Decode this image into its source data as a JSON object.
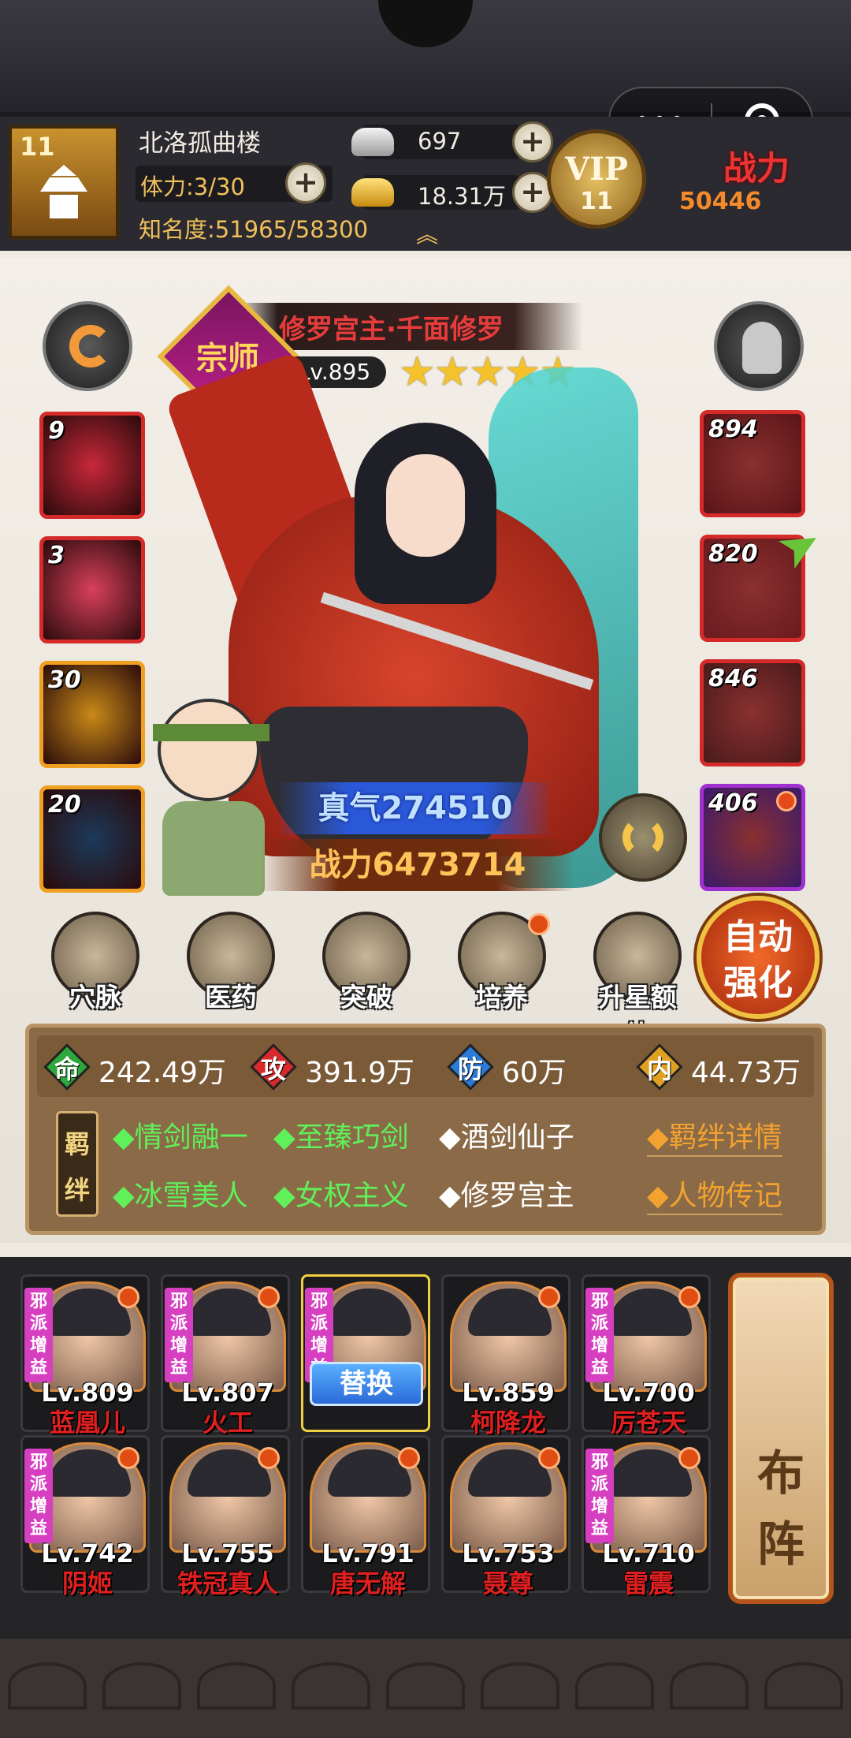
{
  "header": {
    "player_level": "11",
    "player_name": "北洛孤曲楼",
    "stamina": "体力:3/30",
    "fame": "知名度:51965/58300",
    "silver": "697",
    "gold": "18.31万",
    "vip_label": "VIP",
    "vip_level": "11",
    "power_label": "战力",
    "power_value": "50446",
    "capsule_more": "•••"
  },
  "hero": {
    "badge": "宗师",
    "name": "修罗宫主·千面修罗",
    "level": "Lv.895",
    "stars": 5,
    "stars_text": "★★★★★",
    "qi": "真气274510",
    "power": "战力6473714"
  },
  "skills_left": [
    {
      "value": "9",
      "color": "#c8283a"
    },
    {
      "value": "3",
      "color": "#d8405a"
    },
    {
      "value": "30",
      "color": "#c98a18"
    },
    {
      "value": "20",
      "color": "#1c3a5a"
    }
  ],
  "equip_right": [
    {
      "value": "894",
      "color": "#5a1416"
    },
    {
      "value": "820",
      "color": "#6a1a1e"
    },
    {
      "value": "846",
      "color": "#4a1a1a"
    },
    {
      "value": "406",
      "color": "#3a1a6a"
    }
  ],
  "functions": [
    {
      "label": "穴脉",
      "dot": false
    },
    {
      "label": "医药",
      "dot": false
    },
    {
      "label": "突破",
      "dot": false
    },
    {
      "label": "培养",
      "dot": true
    },
    {
      "label": "升星额外",
      "dot": false
    }
  ],
  "auto_upgrade": {
    "line1": "自动",
    "line2": "强化"
  },
  "stats": [
    {
      "key": "命",
      "value": "242.49万",
      "color": "#2ea83a"
    },
    {
      "key": "攻",
      "value": "391.9万",
      "color": "#d82a2a"
    },
    {
      "key": "防",
      "value": "60万",
      "color": "#2a7ad8"
    },
    {
      "key": "内",
      "value": "44.73万",
      "color": "#e0a020"
    }
  ],
  "bond": {
    "tag": "羁绊",
    "row1": [
      "◆情剑融一",
      "◆至臻巧剑",
      "◆酒剑仙子"
    ],
    "row2": [
      "◆冰雪美人",
      "◆女权主义",
      "◆修罗宫主"
    ],
    "link_detail": "◆羁绊详情",
    "link_bio": "◆人物传记"
  },
  "roster": {
    "row1": [
      {
        "level": "Lv.809",
        "name": "蓝凰儿",
        "tag": "邪派增益"
      },
      {
        "level": "Lv.807",
        "name": "火工",
        "tag": "邪派增益"
      },
      {
        "level": "",
        "name": "",
        "tag": "邪派增益",
        "button": "替换"
      },
      {
        "level": "Lv.859",
        "name": "柯降龙",
        "tag": ""
      },
      {
        "level": "Lv.700",
        "name": "厉苍天",
        "tag": "邪派增益"
      }
    ],
    "row2": [
      {
        "level": "Lv.742",
        "name": "阴姬",
        "tag": "邪派增益"
      },
      {
        "level": "Lv.755",
        "name": "铁冠真人",
        "tag": ""
      },
      {
        "level": "Lv.791",
        "name": "唐无解",
        "tag": ""
      },
      {
        "level": "Lv.753",
        "name": "聂尊",
        "tag": ""
      },
      {
        "level": "Lv.710",
        "name": "雷震",
        "tag": "邪派增益"
      }
    ],
    "formation": {
      "line1": "布",
      "line2": "阵"
    }
  }
}
